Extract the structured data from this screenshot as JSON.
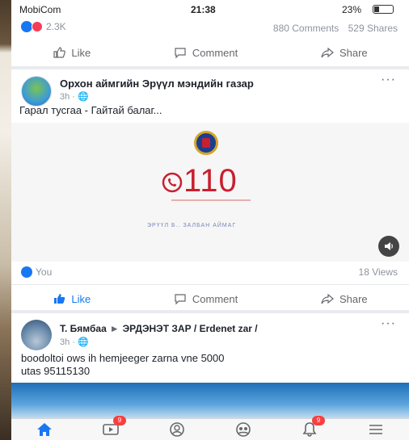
{
  "status_bar": {
    "carrier": "MobiCom",
    "time": "21:38",
    "battery_text": "23%"
  },
  "top_post": {
    "reactions_count": "2.3K",
    "comments": "880 Comments",
    "shares": "529 Shares",
    "actions": {
      "like": "Like",
      "comment": "Comment",
      "share": "Share"
    }
  },
  "video_post": {
    "page_name": "Орхон аймгийн Эрүүл мэндийн газар",
    "meta": "3h · 🌐",
    "more": "···",
    "text": "Гарал тусгаа - Гайтай балаг...",
    "video": {
      "phone_number": "110",
      "caption": "ЭРҮҮЛ Б.. ЗАЛБАН АЙМАГ"
    },
    "viewers": "You",
    "views": "18 Views",
    "actions": {
      "like": "Like",
      "comment": "Comment",
      "share": "Share"
    }
  },
  "shared_post": {
    "author": "Т. Бямбаа",
    "group": "ЭРДЭНЭТ ЗАР / Erdenet zar /",
    "meta": "3h · 🌐",
    "more": "···",
    "text_line1": "boodoltoi ows ih hemjeeger zarna vne 5000",
    "text_line2": "utas 95115130"
  },
  "tab_bar": {
    "items": [
      "home",
      "watch",
      "profile",
      "groups",
      "notifications",
      "menu"
    ],
    "badges": {
      "watch": "9",
      "notifications": "9"
    }
  },
  "colors": {
    "accent": "#1877f2",
    "emergency_red": "#c8202f",
    "badge": "#fa3e3e"
  }
}
